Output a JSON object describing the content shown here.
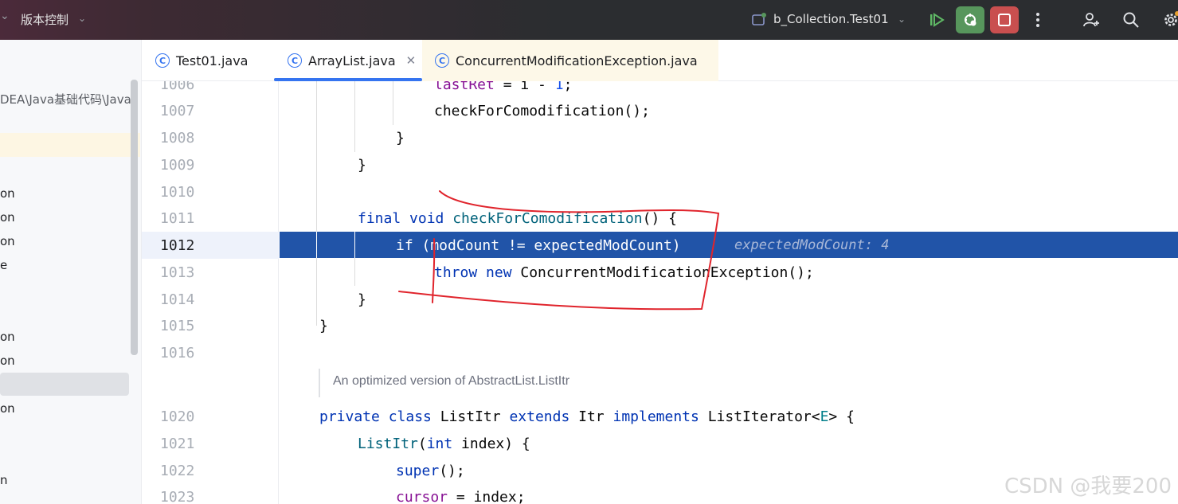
{
  "titlebar": {
    "vcs_label": "版本控制",
    "run_config": "b_Collection.Test01",
    "colors": {
      "debug": "#57965c",
      "stop": "#c94f4f"
    }
  },
  "sidebar": {
    "path_text": "DEA\\Java基础代码\\Java",
    "items": [
      "on",
      "on",
      "on",
      "e",
      "on",
      "on",
      "on",
      "n"
    ]
  },
  "tabs": [
    {
      "label": "Test01.java"
    },
    {
      "label": "ArrayList.java",
      "active": true
    },
    {
      "label": "ConcurrentModificationException.java"
    }
  ],
  "editor": {
    "line_numbers": [
      "1006",
      "1007",
      "1008",
      "1009",
      "1010",
      "1011",
      "1012",
      "1013",
      "1014",
      "1015",
      "1016",
      "1020",
      "1021",
      "1022",
      "1023"
    ],
    "current_line": "1012",
    "inlay_hint": "expectedModCount: 4",
    "doc_comment": "An optimized version of AbstractList.ListItr",
    "highlight_color": "#2154a8"
  },
  "watermark": "CSDN @我要200"
}
